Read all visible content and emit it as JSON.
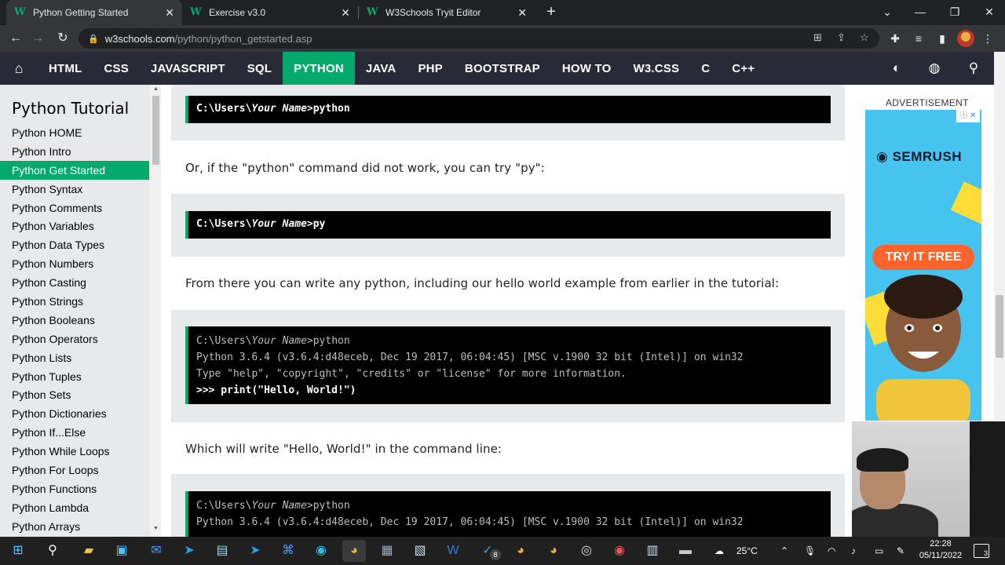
{
  "browser": {
    "tabs": [
      {
        "title": "Python Getting Started",
        "favicon": "W",
        "active": true
      },
      {
        "title": "Exercise v3.0",
        "favicon": "W",
        "active": false
      },
      {
        "title": "W3Schools Tryit Editor",
        "favicon": "W",
        "active": false
      }
    ],
    "new_tab": "+",
    "url_host": "w3schools.com",
    "url_path": "/python/python_getstarted.asp"
  },
  "nav": {
    "items": [
      "HTML",
      "CSS",
      "JAVASCRIPT",
      "SQL",
      "PYTHON",
      "JAVA",
      "PHP",
      "BOOTSTRAP",
      "HOW TO",
      "W3.CSS",
      "C",
      "C++"
    ],
    "active": "PYTHON"
  },
  "sidebar": {
    "title": "Python Tutorial",
    "items": [
      "Python HOME",
      "Python Intro",
      "Python Get Started",
      "Python Syntax",
      "Python Comments",
      "Python Variables",
      "Python Data Types",
      "Python Numbers",
      "Python Casting",
      "Python Strings",
      "Python Booleans",
      "Python Operators",
      "Python Lists",
      "Python Tuples",
      "Python Sets",
      "Python Dictionaries",
      "Python If...Else",
      "Python While Loops",
      "Python For Loops",
      "Python Functions",
      "Python Lambda",
      "Python Arrays"
    ],
    "active_index": 2
  },
  "content": {
    "code1_prefix": "C:\\Users\\",
    "code1_name": "Your Name",
    "code1_cmd": ">python",
    "para1": "Or, if the \"python\" command did not work, you can try \"py\":",
    "code2_prefix": "C:\\Users\\",
    "code2_name": "Your Name",
    "code2_cmd": ">py",
    "para2": "From there you can write any python, including our hello world example from earlier in the tutorial:",
    "code3": {
      "l1_prefix": "C:\\Users\\",
      "l1_name": "Your Name",
      "l1_cmd": ">python",
      "l2": "Python 3.6.4 (v3.6.4:d48eceb, Dec 19 2017, 06:04:45) [MSC v.1900 32 bit (Intel)] on win32",
      "l3": "Type \"help\", \"copyright\", \"credits\" or \"license\" for more information.",
      "l4": ">>> print(\"Hello, World!\")"
    },
    "para3": "Which will write \"Hello, World!\" in the command line:",
    "code4": {
      "l1_prefix": "C:\\Users\\",
      "l1_name": "Your Name",
      "l1_cmd": ">python",
      "l2": "Python 3.6.4 (v3.6.4:d48eceb, Dec 19 2017, 06:04:45) [MSC v.1900 32 bit (Intel)] on win32"
    }
  },
  "ad": {
    "label": "ADVERTISEMENT",
    "brand": "SEMRUSH",
    "cta": "TRY IT FREE"
  },
  "taskbar": {
    "temperature": "25°C",
    "time": "22:28",
    "date": "05/11/2022",
    "notifications": "3",
    "badge": "8"
  },
  "colors": {
    "accent": "#04aa6d",
    "nav_bg": "#282a35",
    "sidebar_bg": "#e7e9eb"
  }
}
